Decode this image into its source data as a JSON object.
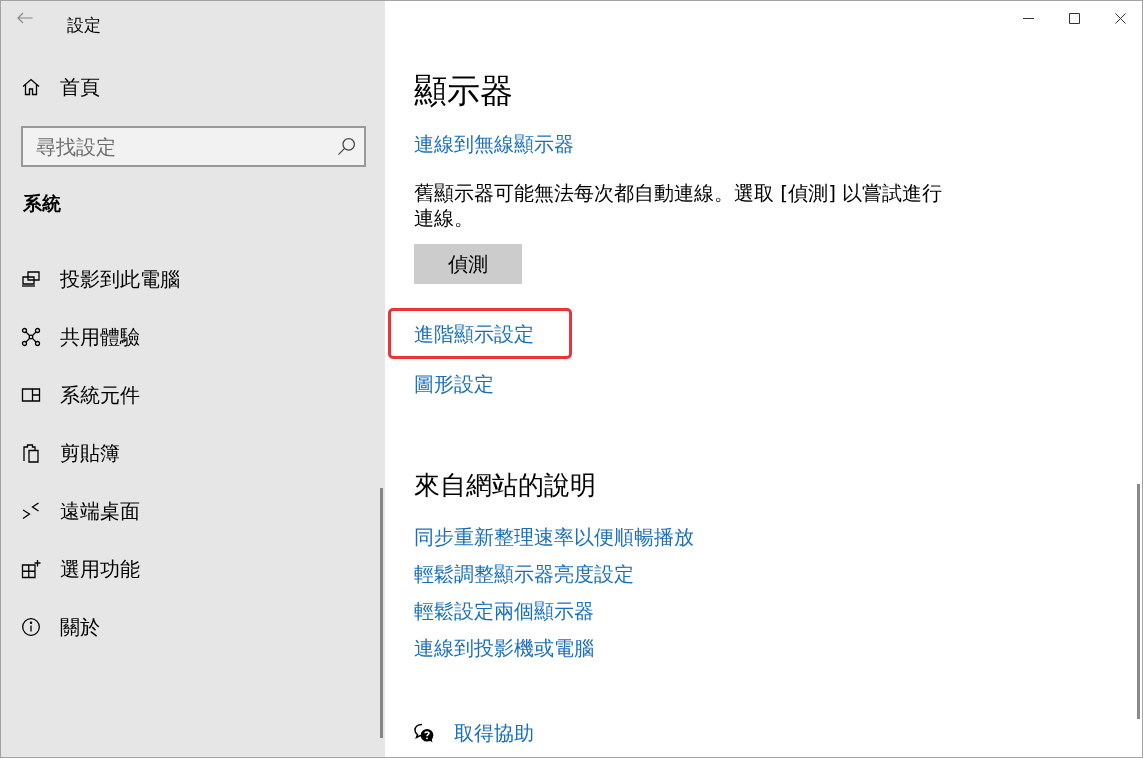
{
  "window": {
    "title": "設定"
  },
  "sidebar": {
    "home": "首頁",
    "search": {
      "placeholder": "尋找設定"
    },
    "section": "系統",
    "items": [
      {
        "label": "投影到此電腦"
      },
      {
        "label": "共用體驗"
      },
      {
        "label": "系統元件"
      },
      {
        "label": "剪貼簿"
      },
      {
        "label": "遠端桌面"
      },
      {
        "label": "選用功能"
      },
      {
        "label": "關於"
      }
    ]
  },
  "content": {
    "title": "顯示器",
    "wireless_link": "連線到無線顯示器",
    "note": "舊顯示器可能無法每次都自動連線。選取 [偵測] 以嘗試進行連線。",
    "detect_button": "偵測",
    "links": [
      {
        "label": "進階顯示設定",
        "highlighted": true
      },
      {
        "label": "圖形設定",
        "highlighted": false
      }
    ],
    "web_help": {
      "title": "來自網站的說明",
      "links": [
        "同步重新整理速率以便順暢播放",
        "輕鬆調整顯示器亮度設定",
        "輕鬆設定兩個顯示器",
        "連線到投影機或電腦"
      ]
    },
    "get_help": "取得協助"
  }
}
